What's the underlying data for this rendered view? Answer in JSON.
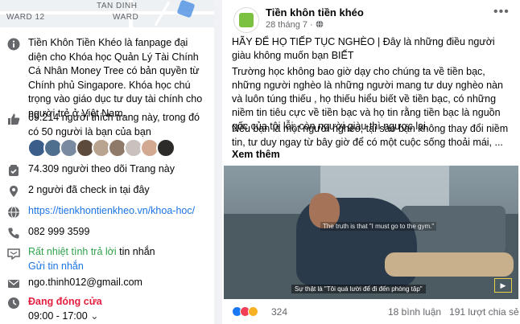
{
  "map": {
    "label_left": "WARD 12",
    "label_top": "TAN DINH",
    "label_top2": "WARD"
  },
  "about": {
    "description": "Tiền Khôn Tiền Khéo là fanpage đại diện cho Khóa học Quản Lý Tài Chính Cá Nhân Money Tree có bản quyền từ Chính phủ Singapore. Khóa học chú trọng vào giáo dục tư duy tài chính cho người trẻ ở Việt Nam.",
    "likes": "69.214 người thích trang này, trong đó có 50 người là bạn của bạn",
    "followers": "74.309 người theo dõi Trang này",
    "checkins": "2 người đã check in tại đây",
    "website": "https://tienkhontienkheo.vn/khoa-hoc/",
    "phone": "082 999 3599",
    "response": "Rất nhiệt tình trả lời",
    "response_suffix": " tin nhắn",
    "send_message": "Gửi tin nhắn",
    "email": "ngo.thinh012@gmail.com",
    "status": "Đang đóng cửa",
    "hours": "09:00 - 17:00",
    "hours_caret": "⌄"
  },
  "icons": {
    "info": "info-icon",
    "like": "thumbs-up-icon",
    "follow": "follow-icon",
    "checkin": "location-pin-icon",
    "web": "globe-icon",
    "phone": "phone-icon",
    "message": "messenger-icon",
    "email": "email-icon",
    "clock": "clock-icon"
  },
  "post": {
    "page_name": "Tiền khôn tiền khéo",
    "date": "28 tháng 7 · ",
    "title": "HÃY ĐỂ HỌ TIẾP TỤC NGHÈO | Đây là những điều người giàu không muốn bạn BIẾT",
    "body1": "Trường học không bao giờ dạy cho chúng ta về tiền bạc, những người nghèo là những người mang tư duy nghèo nàn và luôn túng thiếu , họ thiếu hiểu biết về tiền bạc, có những niềm tin tiêu cực về tiền bạc và họ tin rằng tiền bạc là nguồn gốc của tội lỗi, còn người giàu thì ngược lại.",
    "body2": "Nếu bạn là một người nghèo, tại sao bạn không thay đổi niềm tin, tư duy ngay từ bây giờ để có một cuộc sống thoải mái, ...",
    "see_more": "Xem thêm",
    "video_sub_top": "The truth is that \"I must go to the gym.\"",
    "video_sub_bottom": "Sự thật là \"Tôi quá lười để đi đến phòng tập\"",
    "reaction_count": "324",
    "comments": "18 bình luận",
    "shares": "191 lượt chia sẻ"
  },
  "colors": {
    "link": "#1b74e4",
    "green": "#31a24c",
    "red": "#e41e3f"
  }
}
